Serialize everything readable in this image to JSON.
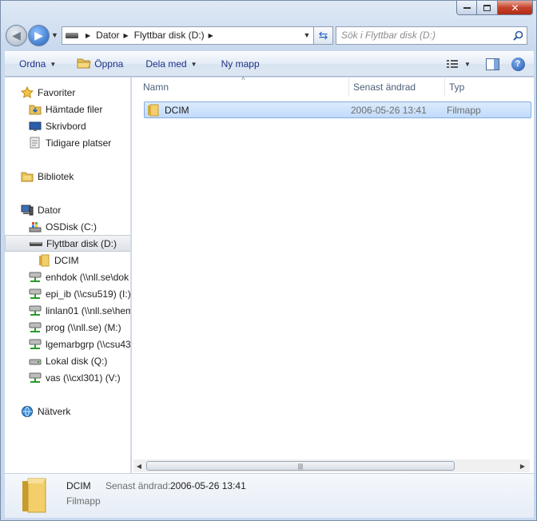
{
  "window": {
    "controls": {
      "minimize_icon": "minimize-icon",
      "maximize_icon": "maximize-icon",
      "close_icon": "close-icon",
      "close_glyph": "✕"
    }
  },
  "address_bar": {
    "breadcrumbs": [
      "Dator",
      "Flyttbar disk (D:)"
    ],
    "drive_icon": "removable-drive-icon"
  },
  "search": {
    "placeholder": "Sök i Flyttbar disk (D:)"
  },
  "toolbar": {
    "ordna": "Ordna",
    "oppna": "Öppna",
    "dela_med": "Dela med",
    "ny_mapp": "Ny mapp"
  },
  "nav_pane": {
    "items": [
      {
        "label": "Favoriter",
        "icon": "star-icon"
      },
      {
        "label": "Hämtade filer",
        "icon": "downloads-folder-icon"
      },
      {
        "label": "Skrivbord",
        "icon": "desktop-icon"
      },
      {
        "label": "Tidigare platser",
        "icon": "recent-places-icon"
      },
      {
        "label": "Bibliotek",
        "icon": "library-icon"
      },
      {
        "label": "Dator",
        "icon": "computer-icon"
      },
      {
        "label": "OSDisk (C:)",
        "icon": "windows-drive-icon"
      },
      {
        "label": "Flyttbar disk (D:)",
        "icon": "removable-drive-icon"
      },
      {
        "label": "DCIM",
        "icon": "folder-icon"
      },
      {
        "label": "enhdok (\\\\nll.se\\dok",
        "icon": "network-drive-icon"
      },
      {
        "label": "epi_ib (\\\\csu519) (I:)",
        "icon": "network-drive-icon"
      },
      {
        "label": "linlan01 (\\\\nll.se\\hem",
        "icon": "network-drive-icon"
      },
      {
        "label": "prog (\\\\nll.se) (M:)",
        "icon": "network-drive-icon"
      },
      {
        "label": "lgemarbgrp (\\\\csu43",
        "icon": "network-drive-icon"
      },
      {
        "label": "Lokal disk (Q:)",
        "icon": "local-disk-icon"
      },
      {
        "label": "vas (\\\\cxl301) (V:)",
        "icon": "network-drive-icon"
      },
      {
        "label": "Nätverk",
        "icon": "network-icon"
      }
    ]
  },
  "file_list": {
    "columns": [
      "Namn",
      "Senast ändrad",
      "Typ"
    ],
    "rows": [
      {
        "name": "DCIM",
        "modified": "2006-05-26 13:41",
        "type": "Filmapp"
      }
    ]
  },
  "details_pane": {
    "name": "DCIM",
    "modified_label": "Senast ändrad:",
    "modified_value": "2006-05-26 13:41",
    "type": "Filmapp"
  },
  "colors": {
    "selection": "#c1dbfc",
    "link_text": "#1e3287",
    "folder": "#e8c15a"
  }
}
